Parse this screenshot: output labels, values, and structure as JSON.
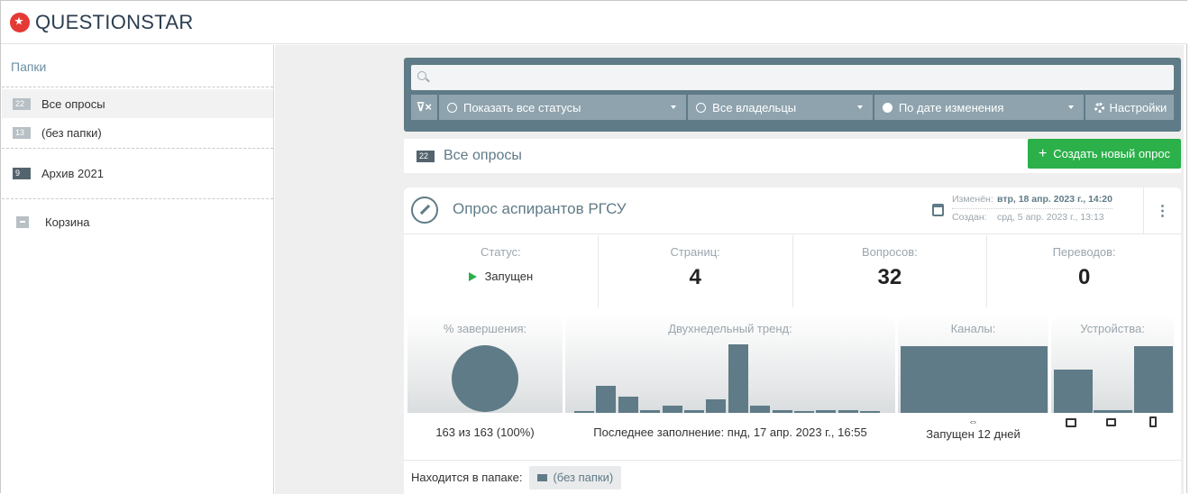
{
  "app": {
    "name": "QUESTIONSTAR"
  },
  "colors": {
    "accent": "#5f7b87",
    "brand": "#e53935",
    "create": "#2bb04a"
  },
  "sidebar": {
    "heading": "Папки",
    "items": [
      {
        "count": "22",
        "label": "Все опросы"
      },
      {
        "count": "13",
        "label": "(без папки)"
      },
      {
        "count": "9",
        "label": "Архив 2021"
      },
      {
        "label": "Корзина"
      }
    ]
  },
  "search": {
    "placeholder": ""
  },
  "filters": {
    "statuses": "Показать все статусы",
    "owners": "Все владельцы",
    "sort": "По дате изменения",
    "settings": "Настройки"
  },
  "list": {
    "count": "22",
    "title": "Все опросы",
    "create_label": "Создать новый опрос"
  },
  "survey": {
    "title": "Опрос аспирантов РГСУ",
    "modified_label": "Изменён:",
    "modified_value": "втр, 18 апр. 2023 г., 14:20",
    "created_label": "Создан:",
    "created_value": "срд, 5 апр. 2023 г., 13:13",
    "stats": {
      "status_label": "Статус:",
      "status_value": "Запущен",
      "pages_label": "Страниц:",
      "pages_value": "4",
      "questions_label": "Вопросов:",
      "questions_value": "32",
      "translations_label": "Переводов:",
      "translations_value": "0"
    },
    "completion": {
      "label": "% завершения:",
      "value": "163 из 163 (100%)",
      "fraction": 1.0
    },
    "trend": {
      "label": "Двухнедельный тренд:",
      "footer": "Последнее заполнение: пнд, 17 апр. 2023 г., 16:55",
      "values": [
        0,
        12,
        7,
        1,
        3,
        1,
        6,
        30,
        3,
        1,
        0,
        1,
        1,
        0
      ]
    },
    "channels": {
      "label": "Каналы:",
      "footer": "Запущен 12 дней",
      "icon": "link-icon",
      "values": [
        1
      ]
    },
    "devices": {
      "label": "Устройства:",
      "icons": [
        "desktop-icon",
        "tablet-icon",
        "phone-icon"
      ],
      "values": [
        0.65,
        0.04,
        1.0
      ]
    },
    "folder_label": "Находится в папаке:",
    "folder_value": "(без папки)"
  }
}
